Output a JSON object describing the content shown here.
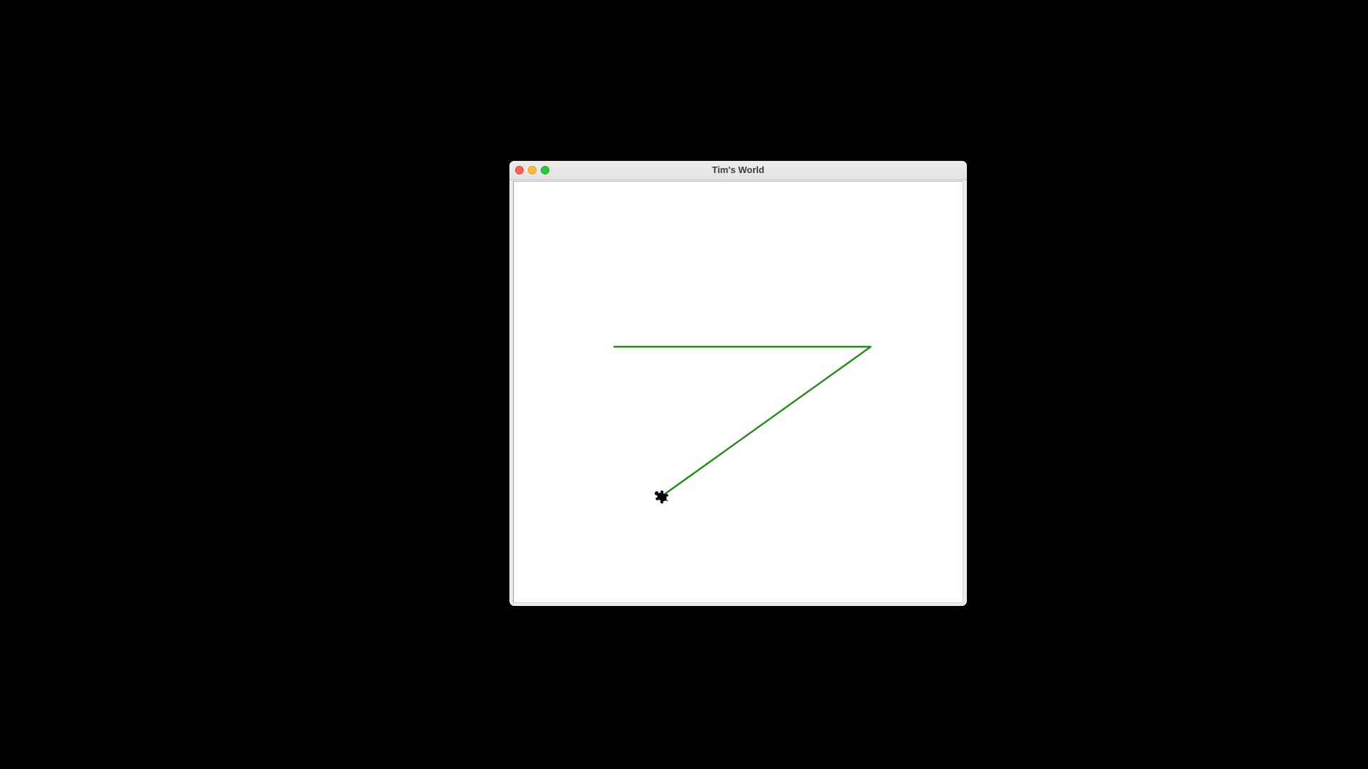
{
  "window": {
    "title": "Tim's World",
    "controls": {
      "close_color": "#ff5f57",
      "minimize_color": "#febc2e",
      "zoom_color": "#28c840"
    }
  },
  "canvas": {
    "background": "#ffffff",
    "pen_color": "#1f8a10",
    "turtle": {
      "shape": "turtle",
      "color": "#000000",
      "icon": "turtle-icon"
    }
  }
}
